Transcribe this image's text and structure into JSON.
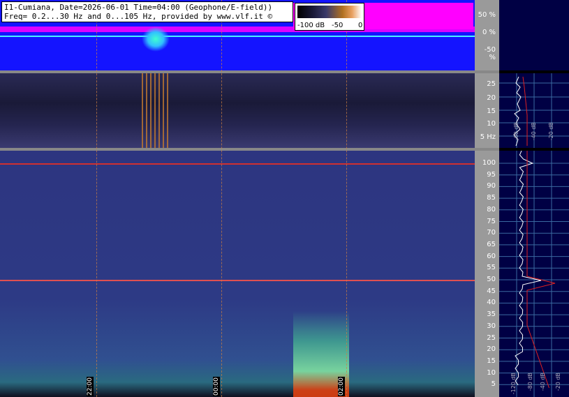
{
  "header": {
    "line1": "I1-Cumiana, Date=2026-06-01 Time=04:00 (Geophone/E-field))",
    "line2": "Freq= 0.2...30 Hz and 0...105 Hz, provided by www.vlf.it ©"
  },
  "colorbar": {
    "labels": [
      "-100 dB",
      "-50",
      "0"
    ]
  },
  "amplitude_scale": {
    "labels": [
      "50 %",
      "0 %",
      "-50 %"
    ]
  },
  "lowfreq_scale": {
    "labels": [
      "25",
      "20",
      "15",
      "10",
      "5 Hz"
    ]
  },
  "highfreq_scale": {
    "labels": [
      "100",
      "95",
      "90",
      "85",
      "80",
      "75",
      "70",
      "65",
      "60",
      "55",
      "50",
      "45",
      "40",
      "35",
      "30",
      "25",
      "20",
      "15",
      "10",
      "5"
    ]
  },
  "time_markers": [
    "22:00",
    "00:00",
    "02:00"
  ],
  "spectrum_db_labels_top": [
    "-60 dB",
    "-40 dB",
    "-20 dB"
  ],
  "spectrum_db_labels_bottom": [
    "-120 dB",
    "-80 dB",
    "-40 dB",
    "-20 dB"
  ],
  "colors": {
    "amplitude_bg": "#1414ff",
    "magenta": "#ff00ff",
    "spectro_bg": "#2a2f7a",
    "side_bg": "#000044"
  }
}
